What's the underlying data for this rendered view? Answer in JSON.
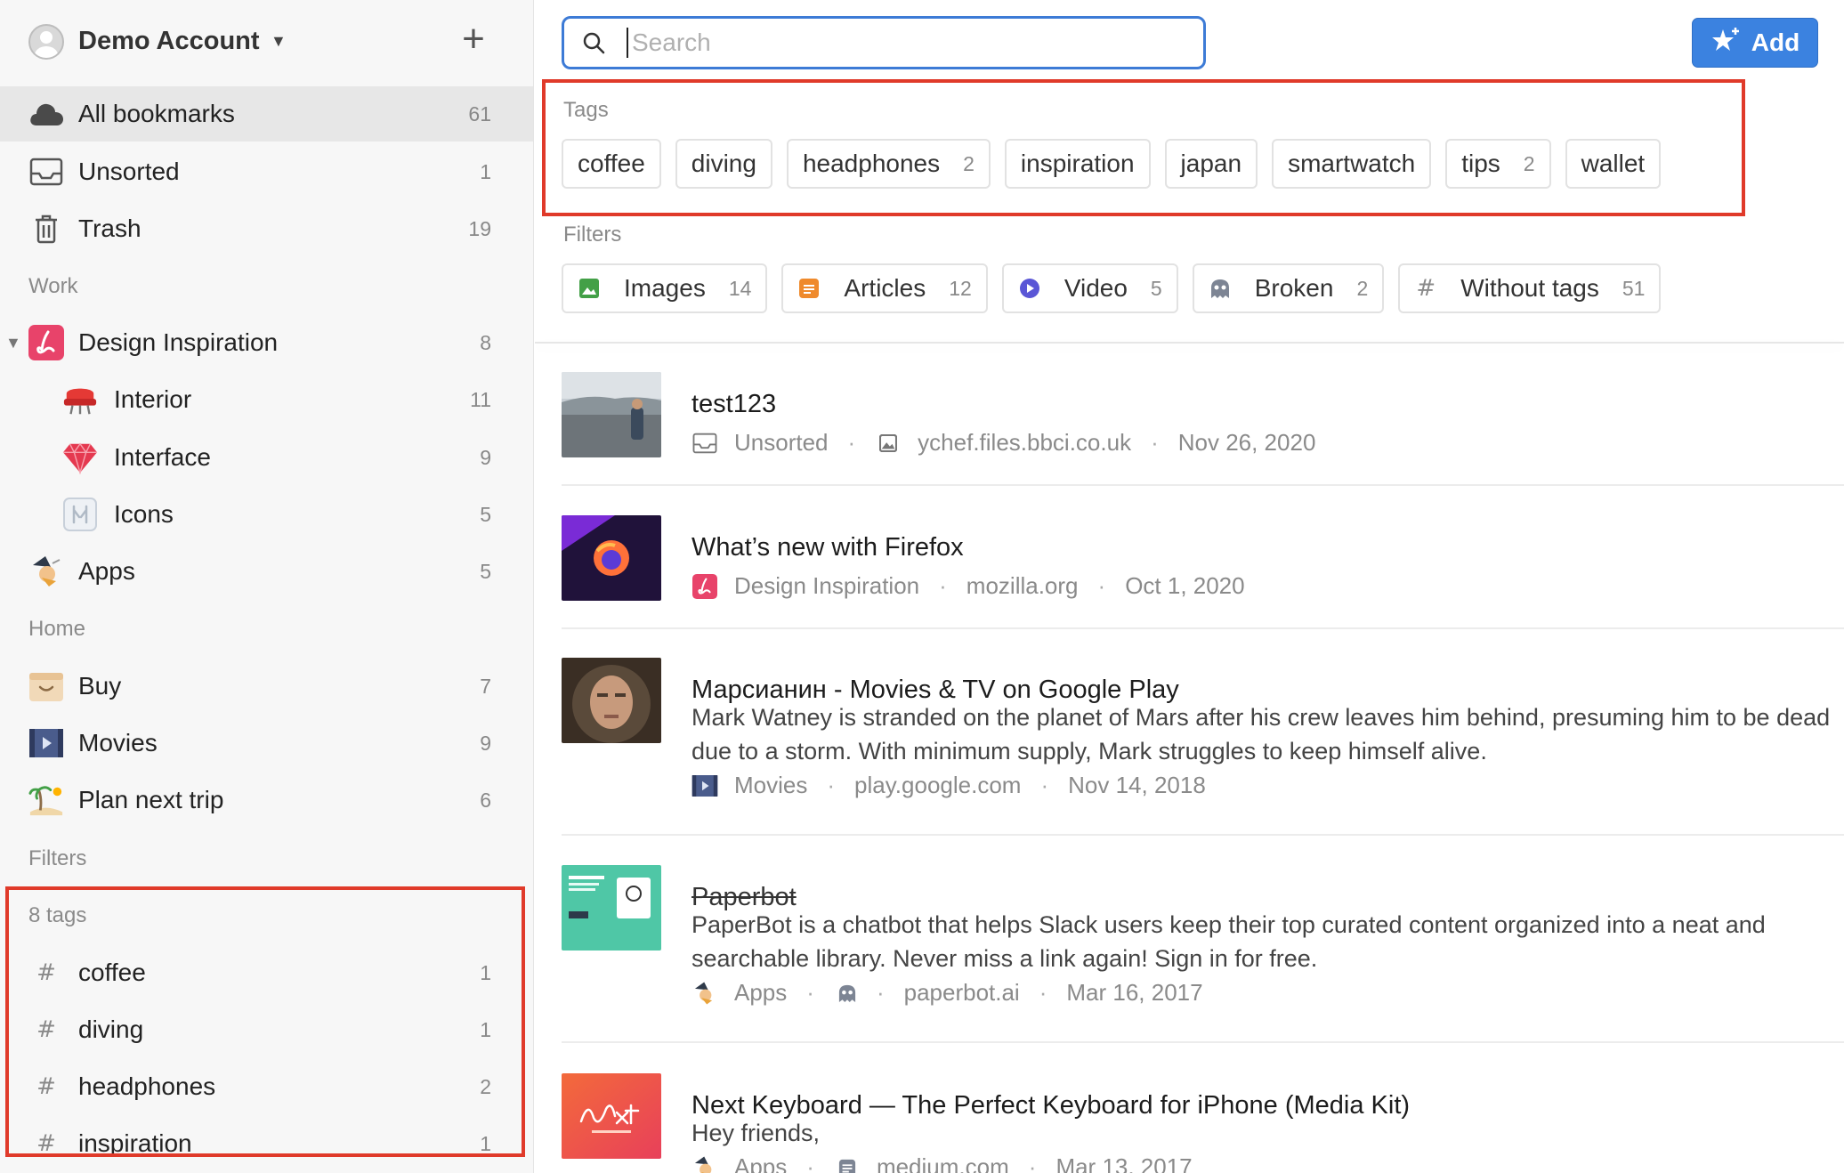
{
  "account": {
    "name": "Demo Account",
    "add_symbol": "+"
  },
  "sidebar": {
    "main_items": [
      {
        "label": "All bookmarks",
        "count": "61"
      },
      {
        "label": "Unsorted",
        "count": "1"
      },
      {
        "label": "Trash",
        "count": "19"
      }
    ],
    "work_label": "Work",
    "work_items": [
      {
        "label": "Design Inspiration",
        "count": "8"
      },
      {
        "label": "Interior",
        "count": "11"
      },
      {
        "label": "Interface",
        "count": "9"
      },
      {
        "label": "Icons",
        "count": "5"
      },
      {
        "label": "Apps",
        "count": "5"
      }
    ],
    "home_label": "Home",
    "home_items": [
      {
        "label": "Buy",
        "count": "7"
      },
      {
        "label": "Movies",
        "count": "9"
      },
      {
        "label": "Plan next trip",
        "count": "6"
      }
    ],
    "filters_label": "Filters",
    "tags_label": "8 tags",
    "tags": [
      {
        "label": "coffee",
        "count": "1"
      },
      {
        "label": "diving",
        "count": "1"
      },
      {
        "label": "headphones",
        "count": "2"
      },
      {
        "label": "inspiration",
        "count": "1"
      }
    ],
    "hash": "#"
  },
  "search": {
    "placeholder": "Search"
  },
  "add_button": {
    "label": "Add"
  },
  "tags_section": {
    "title": "Tags",
    "chips": [
      {
        "label": "coffee",
        "count": ""
      },
      {
        "label": "diving",
        "count": ""
      },
      {
        "label": "headphones",
        "count": "2"
      },
      {
        "label": "inspiration",
        "count": ""
      },
      {
        "label": "japan",
        "count": ""
      },
      {
        "label": "smartwatch",
        "count": ""
      },
      {
        "label": "tips",
        "count": "2"
      },
      {
        "label": "wallet",
        "count": ""
      }
    ]
  },
  "filters_section": {
    "title": "Filters",
    "chips": [
      {
        "label": "Images",
        "count": "14",
        "icon": "image-icon"
      },
      {
        "label": "Articles",
        "count": "12",
        "icon": "article-icon"
      },
      {
        "label": "Video",
        "count": "5",
        "icon": "video-icon"
      },
      {
        "label": "Broken",
        "count": "2",
        "icon": "broken-icon"
      },
      {
        "label": "Without tags",
        "count": "51",
        "icon": "hash-icon"
      }
    ]
  },
  "bookmarks": [
    {
      "title": "test123",
      "excerpt": "",
      "folder": "Unsorted",
      "domain": "ychef.files.bbci.co.uk",
      "date": "Nov 26, 2020"
    },
    {
      "title": "What’s new with Firefox",
      "excerpt": "",
      "folder": "Design Inspiration",
      "domain": "mozilla.org",
      "date": "Oct 1, 2020"
    },
    {
      "title": "Марсианин - Movies & TV on Google Play",
      "excerpt": "Mark Watney is stranded on the planet of Mars after his crew leaves him behind, presuming him to be dead due to a storm. With minimum supply, Mark struggles to keep himself alive.",
      "folder": "Movies",
      "domain": "play.google.com",
      "date": "Nov 14, 2018"
    },
    {
      "title": "Paperbot",
      "excerpt": "PaperBot is a chatbot that helps Slack users keep their top curated content organized into a neat and searchable library. Never miss a link again! Sign in for free.",
      "folder": "Apps",
      "domain": "paperbot.ai",
      "date": "Mar 16, 2017"
    },
    {
      "title": "Next Keyboard — The Perfect Keyboard for iPhone (Media Kit)",
      "excerpt": "Hey friends,",
      "folder": "Apps",
      "domain": "medium.com",
      "date": "Mar 13, 2017"
    }
  ],
  "colors": {
    "accent": "#3b82e0",
    "highlight_box": "#e03a2a"
  }
}
